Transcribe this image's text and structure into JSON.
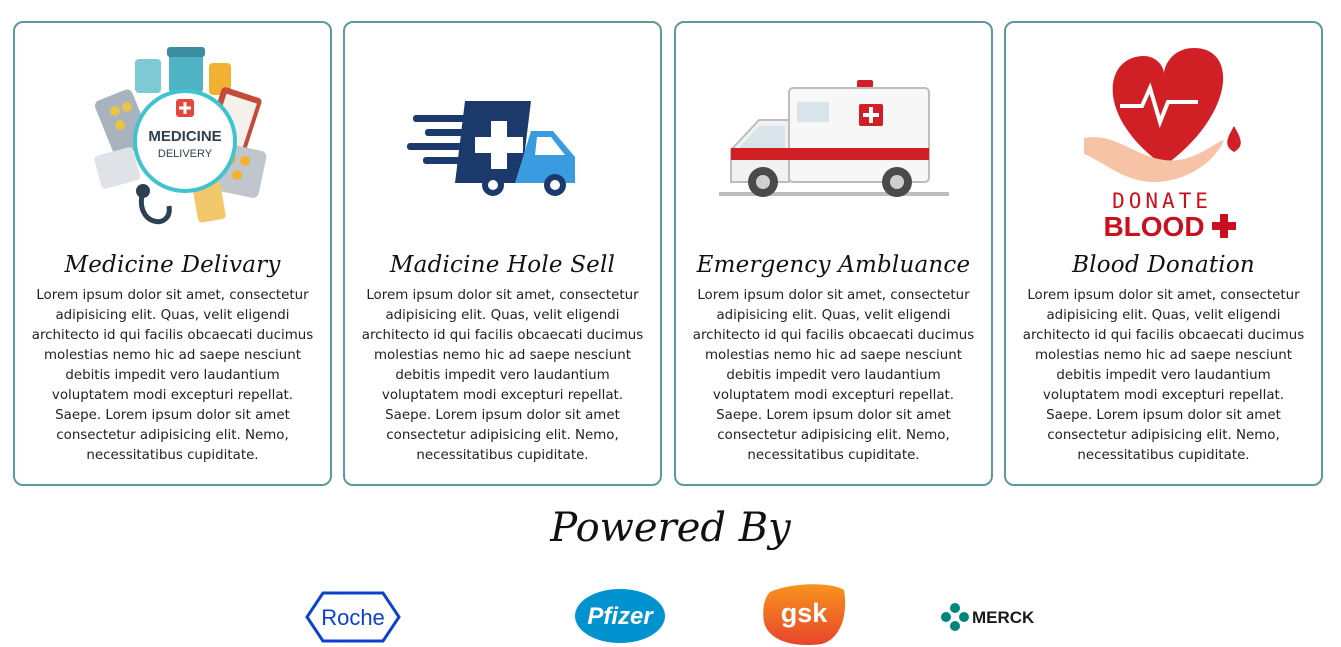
{
  "cards": [
    {
      "title": "Medicine Delivary",
      "text": "Lorem ipsum dolor sit amet, consectetur adipisicing elit. Quas, velit eligendi architecto id qui facilis obcaecati ducimus molestias nemo hic ad saepe nesciunt debitis impedit vero laudantium voluptatem modi excepturi repellat. Saepe. Lorem ipsum dolor sit amet consectetur adipisicing elit. Nemo, necessitatibus cupiditate.",
      "art_line1": "MEDICINE",
      "art_line2": "DELIVERY"
    },
    {
      "title": "Madicine Hole Sell",
      "text": "Lorem ipsum dolor sit amet, consectetur adipisicing elit. Quas, velit eligendi architecto id qui facilis obcaecati ducimus molestias nemo hic ad saepe nesciunt debitis impedit vero laudantium voluptatem modi excepturi repellat. Saepe. Lorem ipsum dolor sit amet consectetur adipisicing elit. Nemo, necessitatibus cupiditate."
    },
    {
      "title": "Emergency Ambluance",
      "text": "Lorem ipsum dolor sit amet, consectetur adipisicing elit. Quas, velit eligendi architecto id qui facilis obcaecati ducimus molestias nemo hic ad saepe nesciunt debitis impedit vero laudantium voluptatem modi excepturi repellat. Saepe. Lorem ipsum dolor sit amet consectetur adipisicing elit. Nemo, necessitatibus cupiditate."
    },
    {
      "title": "Blood Donation",
      "text": "Lorem ipsum dolor sit amet, consectetur adipisicing elit. Quas, velit eligendi architecto id qui facilis obcaecati ducimus molestias nemo hic ad saepe nesciunt debitis impedit vero laudantium voluptatem modi excepturi repellat. Saepe. Lorem ipsum dolor sit amet consectetur adipisicing elit. Nemo, necessitatibus cupiditate.",
      "art_line1": "DONATE",
      "art_line2": "BLOOD"
    }
  ],
  "powered_by": {
    "heading": "Powered By",
    "logos": [
      {
        "name": "Roche",
        "color": "#0b41cd"
      },
      {
        "name": "Pfizer",
        "color": "#0093d0"
      },
      {
        "name": "gsk",
        "color": "#f36633"
      },
      {
        "name": "MERCK",
        "color": "#00857c"
      }
    ]
  },
  "colors": {
    "card_border": "#5e9a9c",
    "navy": "#1b3a6b",
    "red": "#d11f26"
  }
}
